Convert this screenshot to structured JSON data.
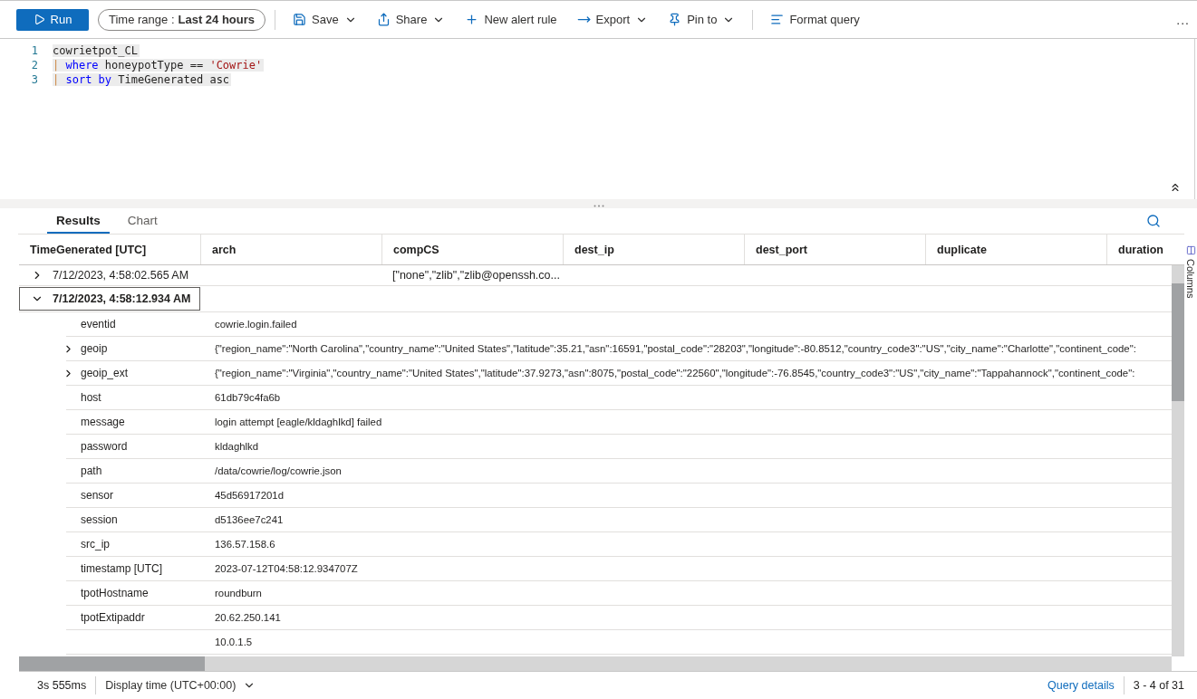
{
  "toolbar": {
    "run": "Run",
    "time_range": {
      "label": "Time range :",
      "value": "Last 24 hours"
    },
    "actions": [
      {
        "kind": "save",
        "label": "Save",
        "dropdown": true
      },
      {
        "kind": "share",
        "label": "Share",
        "dropdown": true
      },
      {
        "kind": "plus",
        "label": "New alert rule",
        "dropdown": false
      },
      {
        "kind": "export",
        "label": "Export",
        "dropdown": true
      },
      {
        "kind": "pin",
        "label": "Pin to",
        "dropdown": true
      },
      {
        "kind": "format",
        "label": "Format query",
        "dropdown": false
      }
    ],
    "more": "..."
  },
  "editor": {
    "lines": [
      {
        "number": "1",
        "tokens": [
          {
            "kind": "plain",
            "text": "cowrietpot_CL"
          }
        ]
      },
      {
        "number": "2",
        "tokens": [
          {
            "kind": "pipe",
            "text": "| "
          },
          {
            "kind": "keyword",
            "text": "where"
          },
          {
            "kind": "plain",
            "text": " honeypotType == "
          },
          {
            "kind": "string",
            "text": "'Cowrie'"
          }
        ]
      },
      {
        "number": "3",
        "tokens": [
          {
            "kind": "pipe",
            "text": "| "
          },
          {
            "kind": "keyword",
            "text": "sort by"
          },
          {
            "kind": "plain",
            "text": " TimeGenerated asc"
          }
        ]
      }
    ]
  },
  "tabs": [
    {
      "label": "Results",
      "selected": true
    },
    {
      "label": "Chart",
      "selected": false
    }
  ],
  "side_panel": {
    "label": "Columns"
  },
  "table": {
    "columns": [
      "TimeGenerated [UTC]",
      "arch",
      "compCS",
      "dest_ip",
      "dest_port",
      "duplicate",
      "duration"
    ],
    "rows": [
      {
        "time": "7/12/2023, 4:58:02.565 AM",
        "compCS": "[\"none\",\"zlib\",\"zlib@openssh.co...",
        "expanded": false,
        "selected": false
      },
      {
        "time": "7/12/2023, 4:58:12.934 AM",
        "expanded": true,
        "selected": true,
        "details": [
          {
            "key": "eventid",
            "value": "cowrie.login.failed"
          },
          {
            "key": "geoip",
            "value": "{\"region_name\":\"North Carolina\",\"country_name\":\"United States\",\"latitude\":35.21,\"asn\":16591,\"postal_code\":\"28203\",\"longitude\":-80.8512,\"country_code3\":\"US\",\"city_name\":\"Charlotte\",\"continent_code\":",
            "expanded": false
          },
          {
            "key": "geoip_ext",
            "value": "{\"region_name\":\"Virginia\",\"country_name\":\"United States\",\"latitude\":37.9273,\"asn\":8075,\"postal_code\":\"22560\",\"longitude\":-76.8545,\"country_code3\":\"US\",\"city_name\":\"Tappahannock\",\"continent_code\":",
            "expanded": false
          },
          {
            "key": "host",
            "value": "61db79c4fa6b"
          },
          {
            "key": "message",
            "value": "login attempt [eagle/kldaghlkd] failed"
          },
          {
            "key": "password",
            "value": "kldaghlkd"
          },
          {
            "key": "path",
            "value": "/data/cowrie/log/cowrie.json"
          },
          {
            "key": "sensor",
            "value": "45d56917201d"
          },
          {
            "key": "session",
            "value": "d5136ee7c241"
          },
          {
            "key": "src_ip",
            "value": "136.57.158.6"
          },
          {
            "key": "timestamp [UTC]",
            "value": "2023-07-12T04:58:12.934707Z"
          },
          {
            "key": "tpotHostname",
            "value": "roundburn"
          },
          {
            "key": "tpotExtipaddr",
            "value": "20.62.250.141"
          },
          {
            "value": "10.0.1.5"
          }
        ]
      }
    ]
  },
  "status_bar": {
    "duration": "3s 555ms",
    "display_time": "Display time (UTC+00:00)",
    "query_details": "Query details",
    "range": "3 - 4 of 31"
  }
}
